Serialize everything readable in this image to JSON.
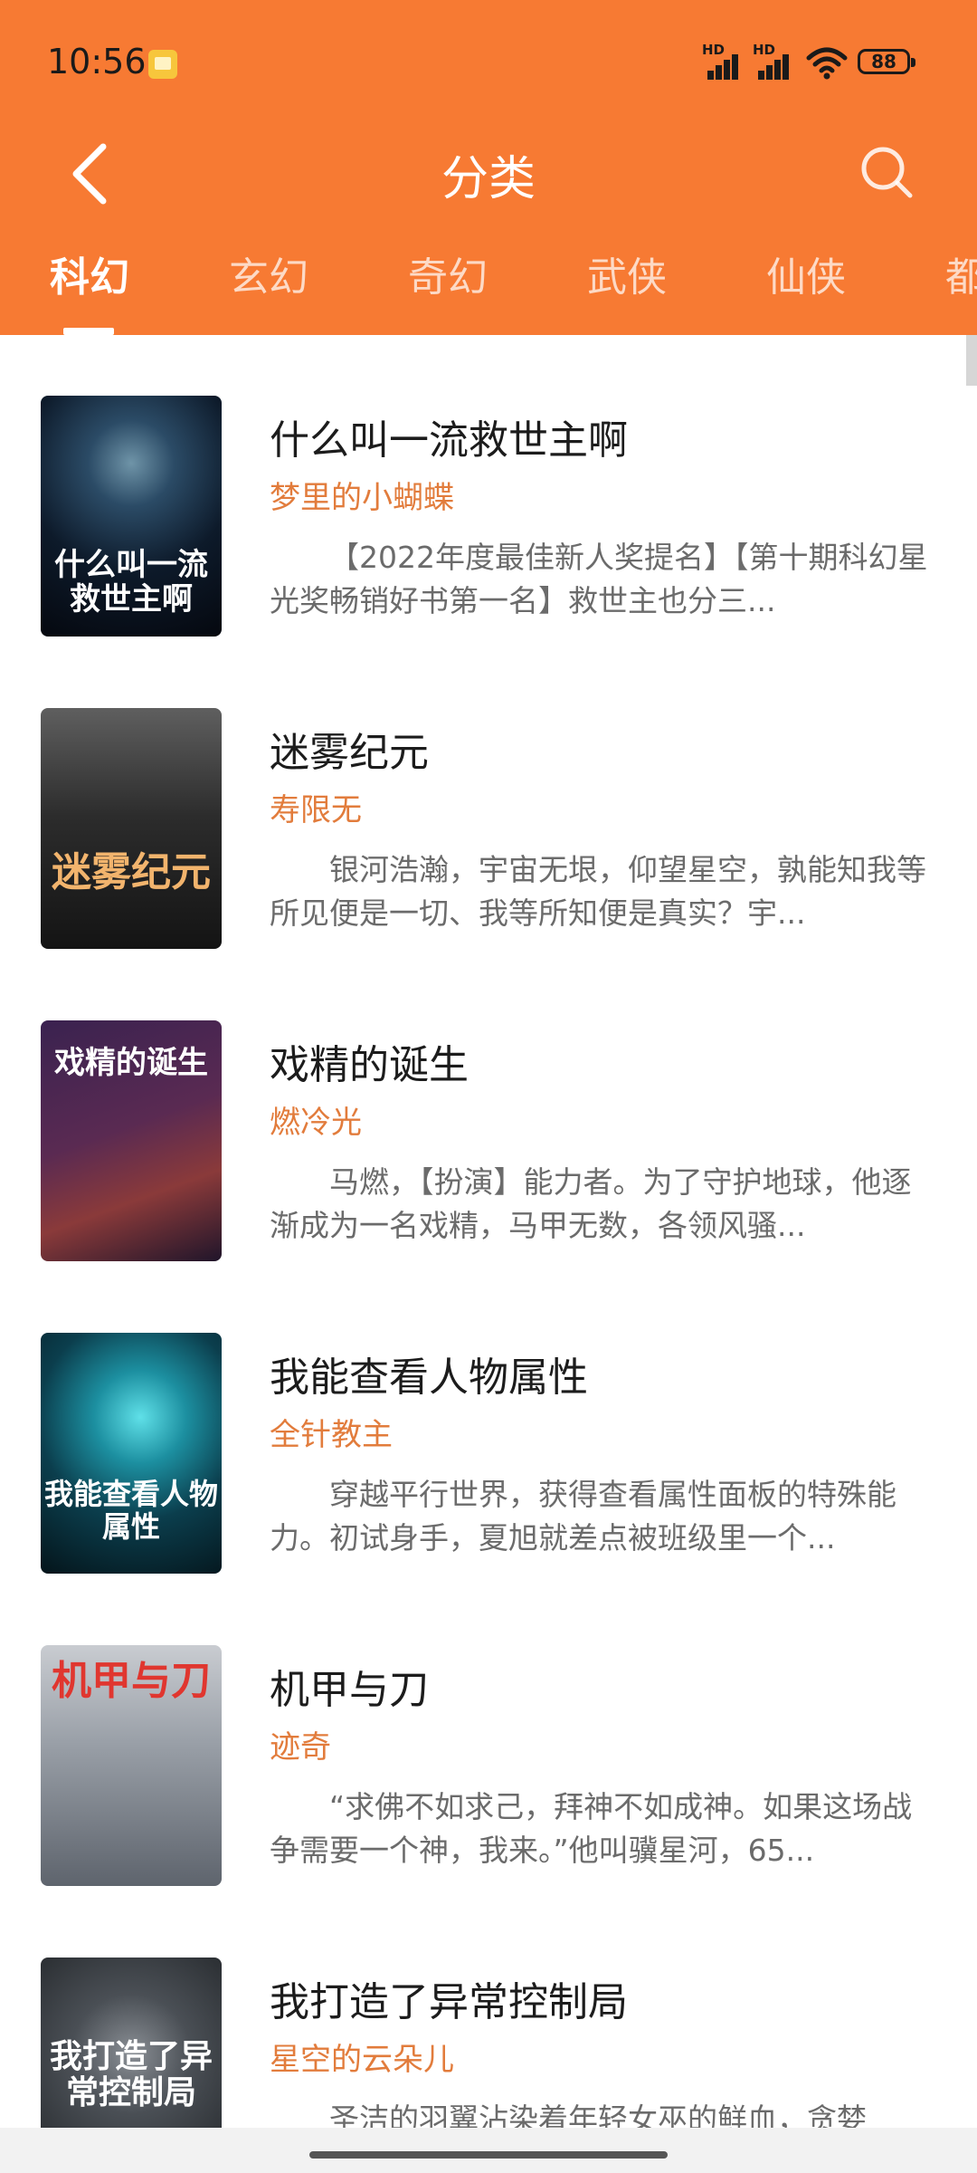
{
  "status_bar": {
    "time": "10:56",
    "signal_label_1": "HD",
    "signal_label_2": "HD",
    "battery": "88"
  },
  "header": {
    "title": "分类",
    "accent_color": "#f77a33"
  },
  "tabs": [
    {
      "label": "科幻",
      "active": true
    },
    {
      "label": "玄幻",
      "active": false
    },
    {
      "label": "奇幻",
      "active": false
    },
    {
      "label": "武侠",
      "active": false
    },
    {
      "label": "仙侠",
      "active": false
    },
    {
      "label": "都",
      "active": false
    }
  ],
  "books": [
    {
      "title": "什么叫一流救世主啊",
      "author": "梦里的小蝴蝶",
      "description": "【2022年度最佳新人奖提名】【第十期科幻星光奖畅销好书第一名】救世主也分三...",
      "cover_text": "什么叫一流救世主啊"
    },
    {
      "title": "迷雾纪元",
      "author": "寿限无",
      "description": "银河浩瀚，宇宙无垠，仰望星空，孰能知我等所见便是一切、我等所知便是真实？宇...",
      "cover_text": "迷雾纪元"
    },
    {
      "title": "戏精的诞生",
      "author": "燃冷光",
      "description": "马燃，【扮演】能力者。为了守护地球，他逐渐成为一名戏精，马甲无数，各领风骚...",
      "cover_text": "戏精的诞生"
    },
    {
      "title": "我能查看人物属性",
      "author": "全针教主",
      "description": "穿越平行世界，获得查看属性面板的特殊能力。初试身手，夏旭就差点被班级里一个...",
      "cover_text": "我能查看人物属性"
    },
    {
      "title": "机甲与刀",
      "author": "迹奇",
      "description": "“求佛不如求己，拜神不如成神。如果这场战争需要一个神，我来。”他叫骥星河，65...",
      "cover_text": "机甲与刀"
    },
    {
      "title": "我打造了异常控制局",
      "author": "星空的云朵儿",
      "description": "圣洁的羽翼沾染着年轻女巫的鲜血，贪婪",
      "cover_text": "我打造了异常控制局"
    }
  ]
}
